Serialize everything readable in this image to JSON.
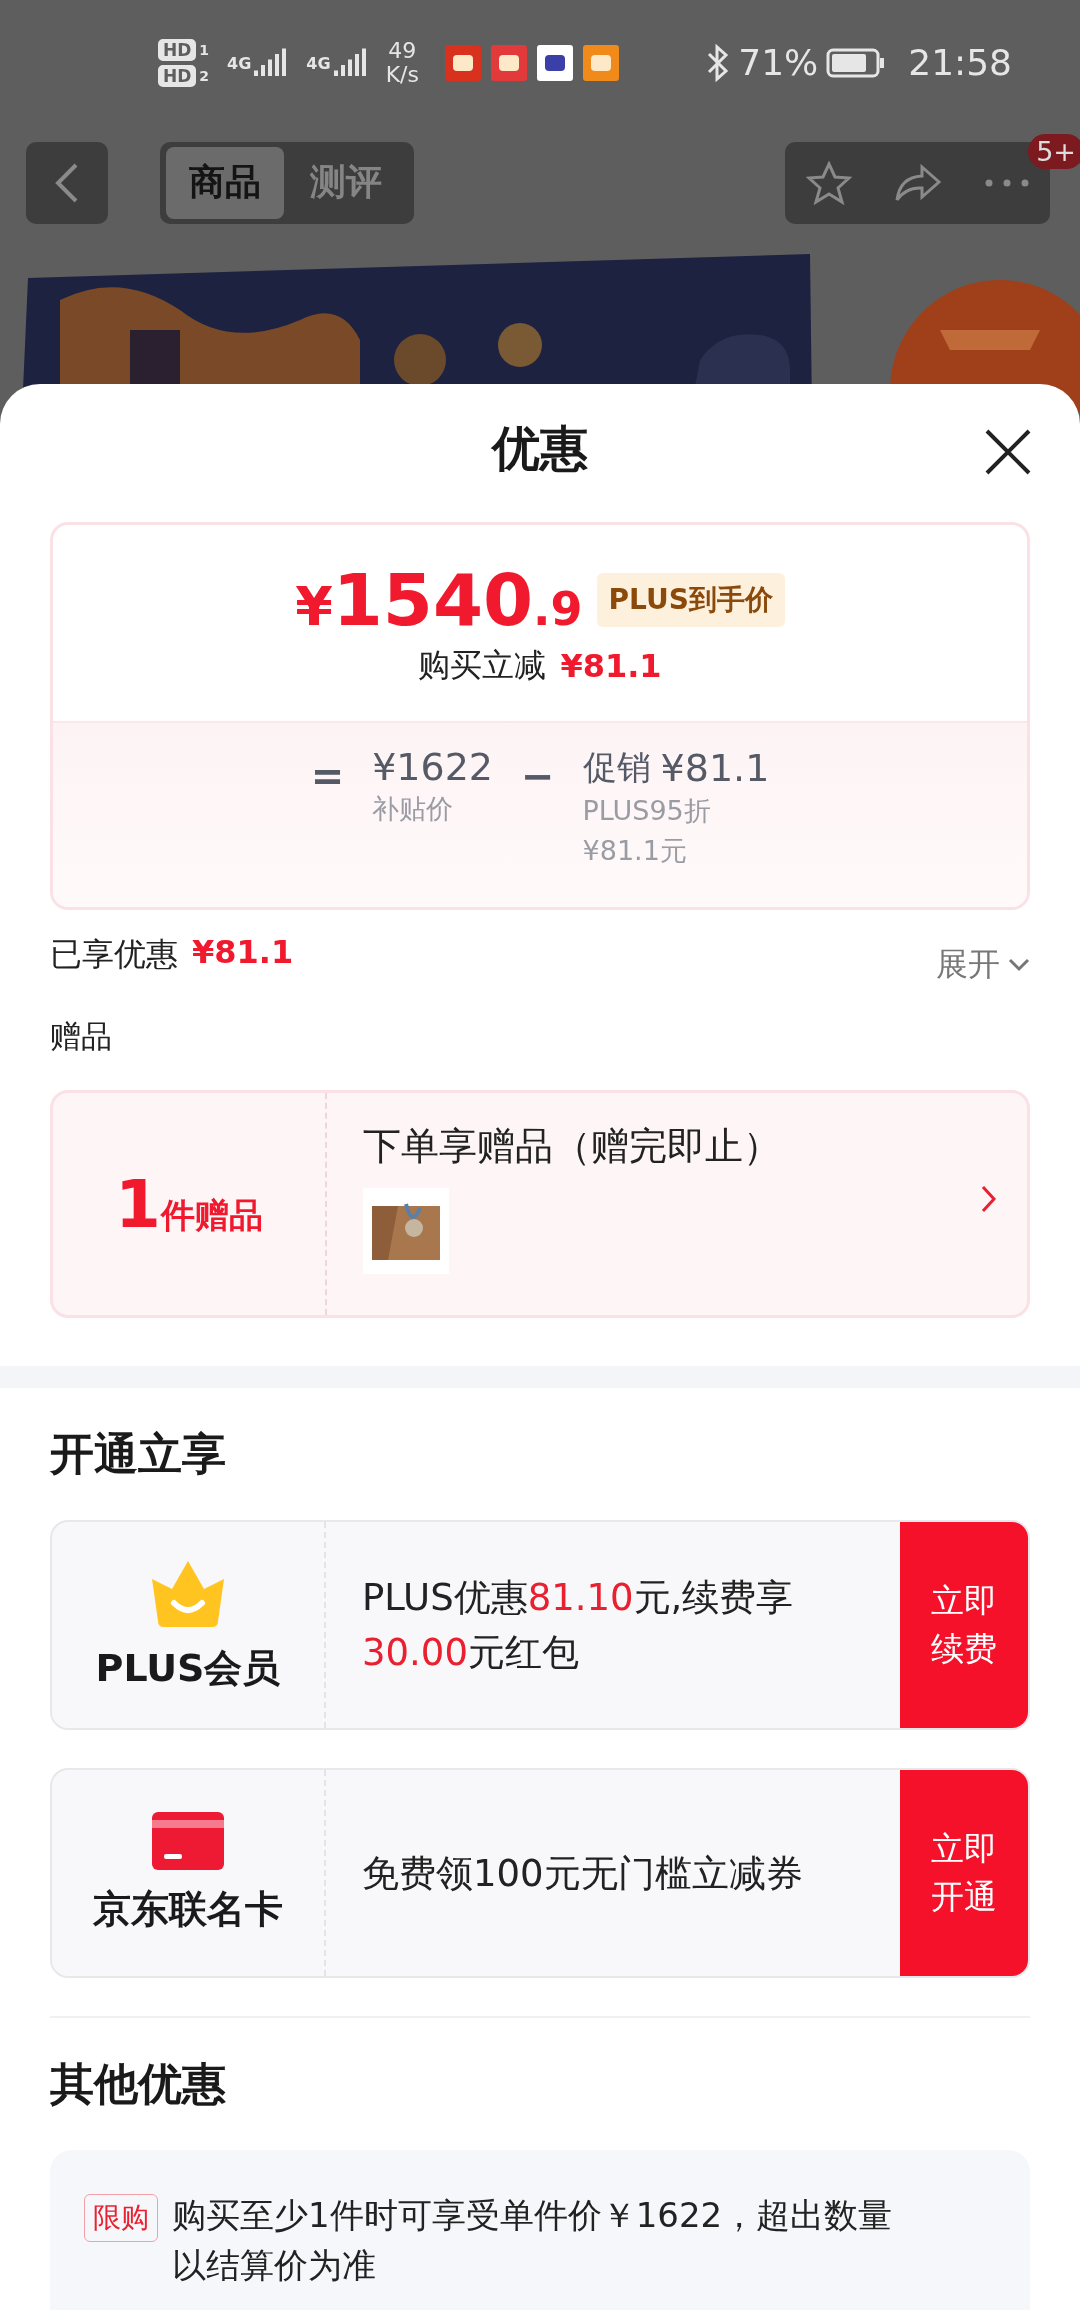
{
  "status_bar": {
    "sims": [
      {
        "label": "HD",
        "slot": "1"
      },
      {
        "label": "HD",
        "slot": "2"
      }
    ],
    "signals": [
      {
        "label": "4G"
      },
      {
        "label": "4G"
      }
    ],
    "speed": "49",
    "speed_unit": "K/s",
    "battery": "71%",
    "time": "21:58"
  },
  "nav": {
    "tabs": [
      {
        "label": "商品",
        "selected": true
      },
      {
        "label": "测评",
        "selected": false
      }
    ],
    "badge": "5+"
  },
  "sheet": {
    "title": "优惠"
  },
  "price_card": {
    "currency": "¥",
    "integer": "1540",
    "decimal": ".9",
    "tag": "PLUS到手价",
    "reduce_label": "购买立减",
    "reduce_amount": "¥81.1",
    "equals": "=",
    "base_price": "¥1622",
    "base_label": "补贴价",
    "minus": "−",
    "promo_label": "促销",
    "promo_amount": "¥81.1",
    "promo_notes": [
      "PLUS95折",
      "¥81.1元"
    ]
  },
  "enjoyed": {
    "label": "已享优惠",
    "amount": "¥81.1",
    "toggle": "展开",
    "expanded": false
  },
  "gifts": {
    "heading": "赠品",
    "count": "1",
    "count_unit": "件赠品",
    "title": "下单享赠品（赠完即止）"
  },
  "open_section": {
    "heading": "开通立享",
    "offers": [
      {
        "kind": "crown",
        "name": "PLUS会员",
        "segments": [
          {
            "text": "PLUS优惠",
            "highlight": false
          },
          {
            "text": "81.10",
            "highlight": true
          },
          {
            "text": "元,续费享",
            "highlight": false
          },
          {
            "text": "30.00",
            "highlight": true
          },
          {
            "text": "元红包",
            "highlight": false
          }
        ],
        "action": "立即续费"
      },
      {
        "kind": "card",
        "name": "京东联名卡",
        "segments": [
          {
            "text": "免费领100元无门槛立减券",
            "highlight": false
          }
        ],
        "action": "立即开通"
      }
    ]
  },
  "other_section": {
    "heading": "其他优惠",
    "items": [
      {
        "tag": "限购",
        "text": "购买至少1件时可享受单件价￥1622，超出数量以结算价为准"
      }
    ]
  }
}
